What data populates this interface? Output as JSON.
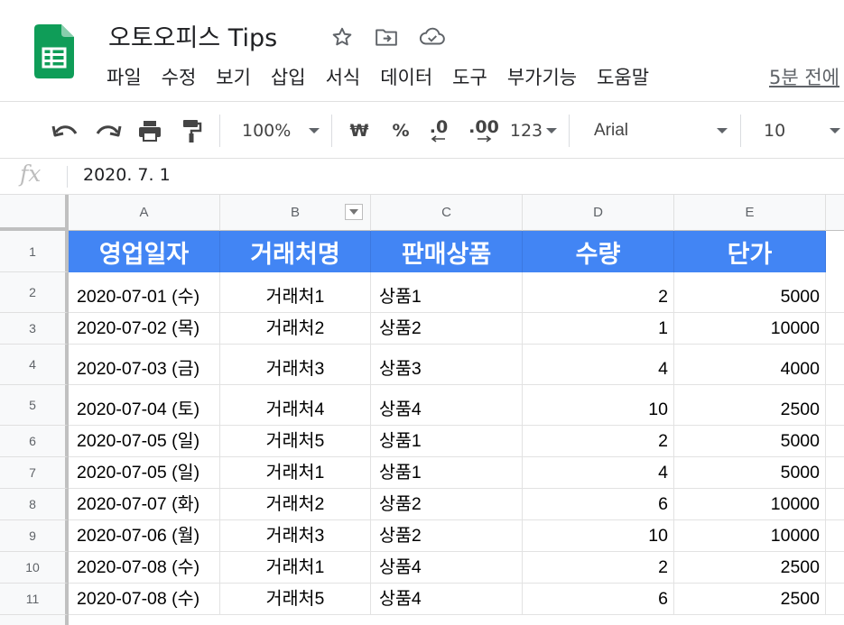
{
  "app": {
    "doc_title": "오토오피스 Tips",
    "last_edit": "5분 전에",
    "menu": [
      "파일",
      "수정",
      "보기",
      "삽입",
      "서식",
      "데이터",
      "도구",
      "부가기능",
      "도움말"
    ],
    "icons": [
      "sheets-logo-icon",
      "star-icon",
      "move-to-folder-icon",
      "cloud-status-icon"
    ]
  },
  "toolbar": {
    "zoom": "100%",
    "currency": "₩",
    "percent": "%",
    "decrease_decimal": ".0",
    "increase_decimal": ".00",
    "number_format": "123",
    "font": "Arial",
    "font_size": "10",
    "icons": [
      "undo-icon",
      "redo-icon",
      "print-icon",
      "paint-format-icon"
    ]
  },
  "formula_bar": {
    "fx_label": "fx",
    "value": "2020. 7. 1"
  },
  "sheet": {
    "columns": [
      "A",
      "B",
      "C",
      "D",
      "E"
    ],
    "header_row_number": "1",
    "headers": [
      "영업일자",
      "거래처명",
      "판매상품",
      "수량",
      "단가"
    ],
    "rows": [
      {
        "num": "2",
        "date": "2020-07-01 (수)",
        "client": "거래처1",
        "product": "상품1",
        "qty": "2",
        "price": "5000"
      },
      {
        "num": "3",
        "date": "2020-07-02 (목)",
        "client": "거래처2",
        "product": "상품2",
        "qty": "1",
        "price": "10000"
      },
      {
        "num": "4",
        "date": "2020-07-03 (금)",
        "client": "거래처3",
        "product": "상품3",
        "qty": "4",
        "price": "4000"
      },
      {
        "num": "5",
        "date": "2020-07-04 (토)",
        "client": "거래처4",
        "product": "상품4",
        "qty": "10",
        "price": "2500"
      },
      {
        "num": "6",
        "date": "2020-07-05 (일)",
        "client": "거래처5",
        "product": "상품1",
        "qty": "2",
        "price": "5000"
      },
      {
        "num": "7",
        "date": "2020-07-05 (일)",
        "client": "거래처1",
        "product": "상품1",
        "qty": "4",
        "price": "5000"
      },
      {
        "num": "8",
        "date": "2020-07-07 (화)",
        "client": "거래처2",
        "product": "상품2",
        "qty": "6",
        "price": "10000"
      },
      {
        "num": "9",
        "date": "2020-07-06 (월)",
        "client": "거래처3",
        "product": "상품2",
        "qty": "10",
        "price": "10000"
      },
      {
        "num": "10",
        "date": "2020-07-08 (수)",
        "client": "거래처1",
        "product": "상품4",
        "qty": "2",
        "price": "2500"
      },
      {
        "num": "11",
        "date": "2020-07-08 (수)",
        "client": "거래처5",
        "product": "상품4",
        "qty": "6",
        "price": "2500"
      }
    ]
  },
  "colors": {
    "header_fill": "#4285f4",
    "header_text": "#ffffff",
    "logo_green": "#0f9d58"
  }
}
